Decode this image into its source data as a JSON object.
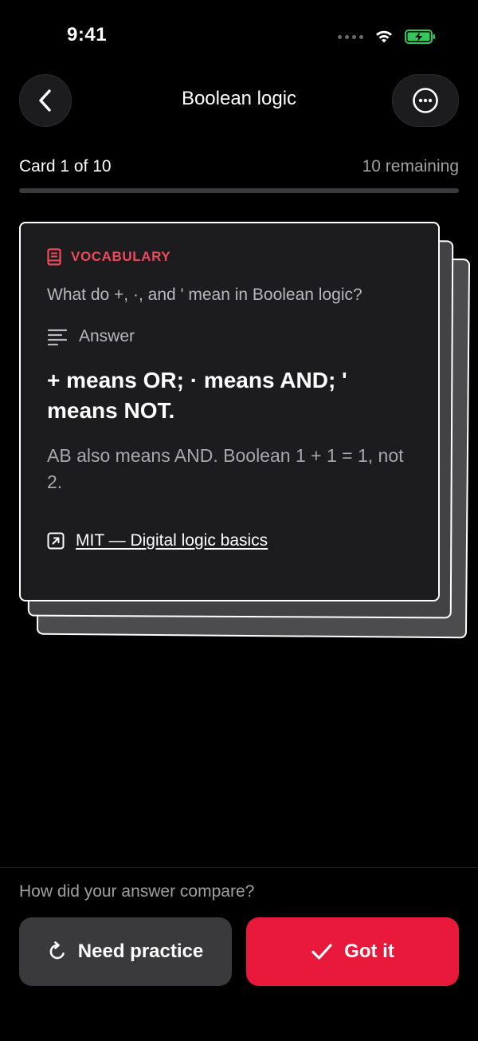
{
  "status_bar": {
    "time": "9:41"
  },
  "header": {
    "title": "Boolean logic",
    "back_icon": "chevron-left-icon",
    "more_icon": "more-horizontal-icon"
  },
  "progress": {
    "current_label": "Card 1 of 10",
    "remaining_label": "10 remaining",
    "fraction_complete": 0
  },
  "card": {
    "tag": "VOCABULARY",
    "tag_icon": "book-icon",
    "question": "What do +, ·, and ' mean in Boolean logic?",
    "answer_label": "Answer",
    "answer_icon": "text-lines-icon",
    "answer_main": "+ means OR; · means AND; ' means NOT.",
    "answer_note": "AB also means AND. Boolean 1 + 1 = 1, not 2.",
    "source_link": "MIT — Digital logic basics",
    "source_icon": "external-link-icon"
  },
  "feedback": {
    "prompt": "How did your answer compare?",
    "need_practice_label": "Need practice",
    "need_practice_icon": "refresh-icon",
    "got_it_label": "Got it",
    "got_it_icon": "checkmark-icon"
  },
  "colors": {
    "accent_red": "#e8193a",
    "tag_red": "#ee4a5a",
    "battery_green": "#34c759"
  }
}
